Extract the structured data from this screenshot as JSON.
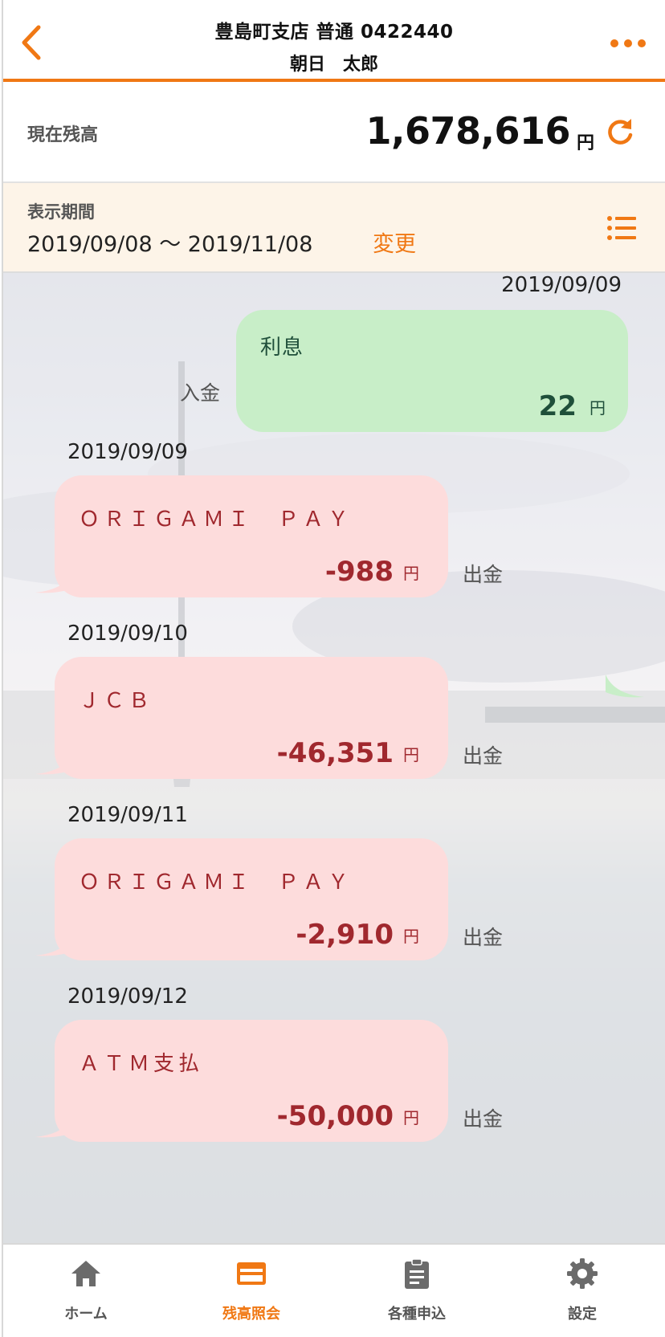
{
  "header": {
    "title": "豊島町支店 普通 0422440",
    "subtitle": "朝日　太郎"
  },
  "balance": {
    "label": "現在残高",
    "amount": "1,678,616",
    "currency": "円"
  },
  "period": {
    "label": "表示期間",
    "range": "2019/09/08 〜 2019/11/08",
    "change_label": "変更"
  },
  "transactions": [
    {
      "date": "2019/09/09",
      "name": "利息",
      "amount": "22",
      "currency": "円",
      "type": "入金",
      "direction": "in"
    },
    {
      "date": "2019/09/09",
      "name": "ＯＲＩＧＡＭＩ　ＰＡＹ",
      "amount": "-988",
      "currency": "円",
      "type": "出金",
      "direction": "out"
    },
    {
      "date": "2019/09/10",
      "name": "ＪＣＢ",
      "amount": "-46,351",
      "currency": "円",
      "type": "出金",
      "direction": "out"
    },
    {
      "date": "2019/09/11",
      "name": "ＯＲＩＧＡＭＩ　ＰＡＹ",
      "amount": "-2,910",
      "currency": "円",
      "type": "出金",
      "direction": "out"
    },
    {
      "date": "2019/09/12",
      "name": "ＡＴＭ支払",
      "amount": "-50,000",
      "currency": "円",
      "type": "出金",
      "direction": "out"
    }
  ],
  "nav": {
    "items": [
      {
        "label": "ホーム",
        "icon": "home-icon",
        "active": false
      },
      {
        "label": "残高照会",
        "icon": "card-icon",
        "active": true
      },
      {
        "label": "各種申込",
        "icon": "clipboard-icon",
        "active": false
      },
      {
        "label": "設定",
        "icon": "gear-icon",
        "active": false
      }
    ]
  },
  "colors": {
    "accent": "#f07814",
    "deposit_bubble": "#c8eec8",
    "withdrawal_bubble": "#fddcdc",
    "withdrawal_text": "#a0282e",
    "deposit_text": "#1f4f3a",
    "period_bg": "#fdf4e8"
  }
}
